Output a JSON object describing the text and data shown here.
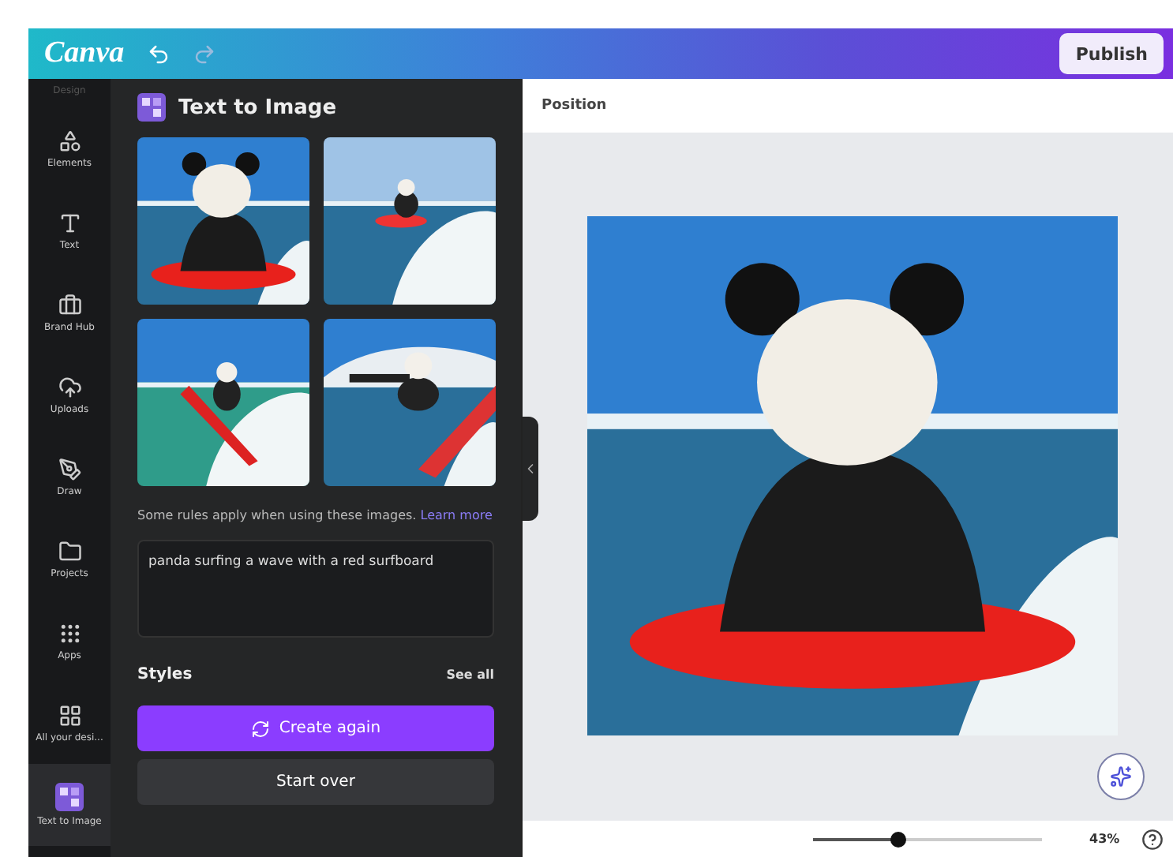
{
  "topbar": {
    "logo": "Canva",
    "publish": "Publish"
  },
  "rail": {
    "cut_label": "Design",
    "items": [
      {
        "label": "Elements",
        "selected": false
      },
      {
        "label": "Text",
        "selected": false
      },
      {
        "label": "Brand Hub",
        "selected": false
      },
      {
        "label": "Uploads",
        "selected": false
      },
      {
        "label": "Draw",
        "selected": false
      },
      {
        "label": "Projects",
        "selected": false
      },
      {
        "label": "Apps",
        "selected": false
      },
      {
        "label": "All your desi...",
        "selected": false
      },
      {
        "label": "Text to Image",
        "selected": true
      }
    ]
  },
  "panel": {
    "title": "Text to Image",
    "note": "Some rules apply when using these images.",
    "note_link": "Learn more",
    "prompt": "panda surfing a wave with a red surfboard",
    "styles": "Styles",
    "see_all": "See all",
    "create": "Create again",
    "start_over": "Start over"
  },
  "canvas": {
    "header": "Position"
  },
  "bottombar": {
    "zoom": {
      "level": 0.37
    },
    "percent": "43%"
  }
}
